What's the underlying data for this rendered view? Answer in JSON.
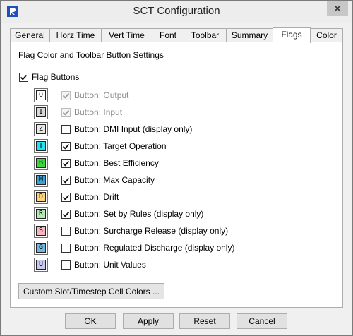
{
  "window": {
    "title": "SCT Configuration"
  },
  "tabs": [
    "General",
    "Horz Time",
    "Vert Time",
    "Font",
    "Toolbar",
    "Summary",
    "Flags",
    "Color"
  ],
  "active_tab": "Flags",
  "panel": {
    "section_title": "Flag Color and Toolbar Button Settings",
    "master_label": "Flag Buttons",
    "master_checked": true,
    "rows": [
      {
        "letter": "O",
        "label": "Button: Output",
        "checked": true,
        "enabled": false,
        "color": "#ffffff"
      },
      {
        "letter": "I",
        "label": "Button: Input",
        "checked": true,
        "enabled": false,
        "color": "#d8d8d8"
      },
      {
        "letter": "Z",
        "label": "Button: DMI Input (display only)",
        "checked": false,
        "enabled": true,
        "color": "#e8e8e8"
      },
      {
        "letter": "T",
        "label": "Button: Target Operation",
        "checked": true,
        "enabled": true,
        "color": "#22e2f0"
      },
      {
        "letter": "B",
        "label": "Button: Best Efficiency",
        "checked": true,
        "enabled": true,
        "color": "#3dd83d"
      },
      {
        "letter": "M",
        "label": "Button: Max Capacity",
        "checked": true,
        "enabled": true,
        "color": "#3ba0d8"
      },
      {
        "letter": "D",
        "label": "Button: Drift",
        "checked": true,
        "enabled": true,
        "color": "#ffd27a"
      },
      {
        "letter": "R",
        "label": "Button: Set by Rules (display only)",
        "checked": true,
        "enabled": true,
        "color": "#b4eab4"
      },
      {
        "letter": "S",
        "label": "Button: Surcharge Release (display only)",
        "checked": false,
        "enabled": true,
        "color": "#f5b8c2"
      },
      {
        "letter": "G",
        "label": "Button: Regulated Discharge (display only)",
        "checked": false,
        "enabled": true,
        "color": "#70b7e4"
      },
      {
        "letter": "U",
        "label": "Button: Unit Values",
        "checked": false,
        "enabled": true,
        "color": "#c9c9ef"
      }
    ],
    "custom_button": "Custom Slot/Timestep Cell Colors ..."
  },
  "buttons": {
    "ok": "OK",
    "apply": "Apply",
    "reset": "Reset",
    "cancel": "Cancel"
  }
}
